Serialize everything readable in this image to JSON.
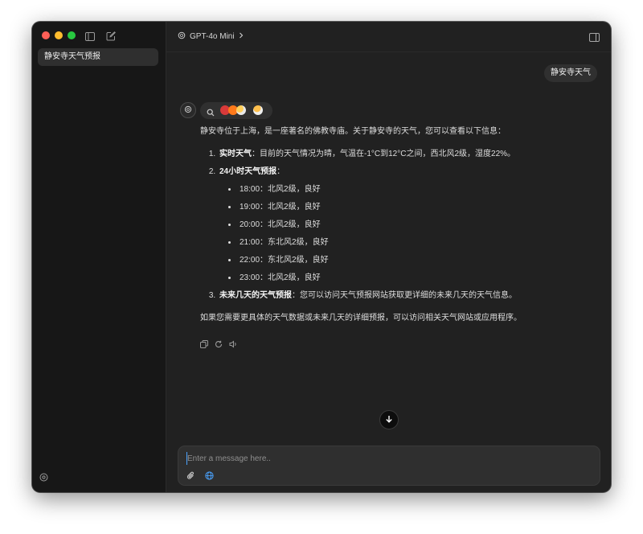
{
  "sidebar": {
    "conversations": [
      "静安寺天气预报"
    ]
  },
  "header": {
    "model_name": "GPT-4o Mini"
  },
  "chat": {
    "user_message": "静安寺天气",
    "assistant": {
      "intro": "静安寺位于上海，是一座著名的佛教寺庙。关于静安寺的天气，您可以查看以下信息：",
      "items": [
        {
          "title": "实时天气",
          "sep": "：",
          "text": "目前的天气情况为晴，气温在-1°C到12°C之间，西北风2级，湿度22%。"
        },
        {
          "title": "24小时天气预报",
          "sep": "：",
          "text": ""
        },
        {
          "title": "未来几天的天气预报",
          "sep": "：",
          "text": "您可以访问天气预报网站获取更详细的未来几天的天气信息。"
        }
      ],
      "hourly": [
        "18:00：北风2级，良好",
        "19:00：北风2级，良好",
        "20:00：北风2级，良好",
        "21:00：东北风2级，良好",
        "22:00：东北风2级，良好",
        "23:00：北风2级，良好"
      ],
      "closing": "如果您需要更具体的天气数据或未来几天的详细预报，可以访问相关天气网站或应用程序。"
    }
  },
  "composer": {
    "placeholder": "Enter a message here..",
    "value": ""
  },
  "icons": {
    "sidebar_toggle": "sidebar-toggle-icon",
    "new_chat": "new-chat-icon",
    "model": "openai-logo-icon",
    "chevron": "chevron-right-icon",
    "right_panel": "right-panel-icon",
    "search": "search-icon",
    "copy": "copy-icon",
    "regenerate": "refresh-icon",
    "speaker": "speaker-icon",
    "arrow_down": "arrow-down-icon",
    "attach": "paperclip-icon",
    "web": "globe-icon",
    "settings": "settings-icon"
  },
  "colors": {
    "traffic_red": "#ff5f57",
    "traffic_yellow": "#febc2e",
    "traffic_green": "#28c840",
    "accent": "#4aa3ff"
  }
}
